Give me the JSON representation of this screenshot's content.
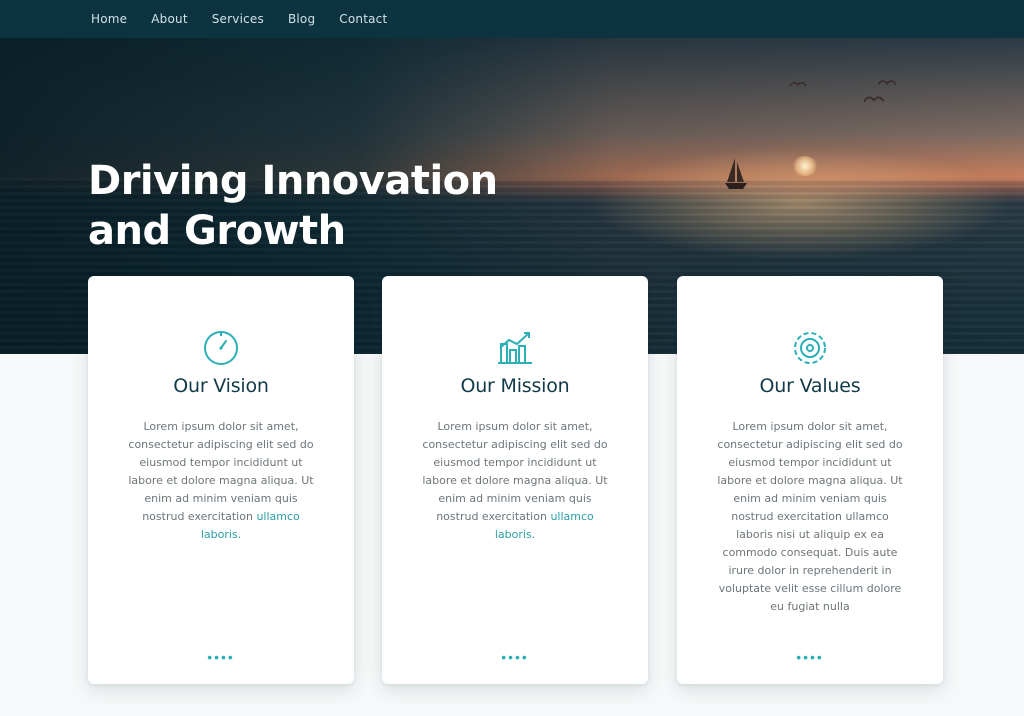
{
  "nav": {
    "items": [
      "Home",
      "About",
      "Services",
      "Blog",
      "Contact"
    ]
  },
  "hero": {
    "title_line1": "Driving Innovation",
    "title_line2": "and Growth"
  },
  "cards": [
    {
      "icon": "clock-icon",
      "title": "Our Vision",
      "body": "Lorem ipsum dolor sit amet, consectetur adipiscing elit sed do eiusmod tempor incididunt ut labore et dolore magna aliqua. Ut enim ad minim veniam quis nostrud exercitation",
      "link": "ullamco laboris.",
      "more": "••••"
    },
    {
      "icon": "growth-chart-icon",
      "title": "Our Mission",
      "body": "Lorem ipsum dolor sit amet, consectetur adipiscing elit sed do eiusmod tempor incididunt ut labore et dolore magna aliqua. Ut enim ad minim veniam quis nostrud exercitation",
      "link": "ullamco laboris.",
      "more": "••••"
    },
    {
      "icon": "gear-icon",
      "title": "Our Values",
      "body": "Lorem ipsum dolor sit amet, consectetur adipiscing elit sed do eiusmod tempor incididunt ut labore et dolore magna aliqua. Ut enim ad minim veniam quis nostrud exercitation ullamco laboris nisi ut aliquip ex ea commodo consequat. Duis aute irure dolor in reprehenderit in voluptate velit esse cillum dolore eu fugiat nulla",
      "link": "",
      "more": "••••"
    }
  ],
  "colors": {
    "nav_bg": "#0d3340",
    "accent": "#2ab0b6",
    "heading": "#133a48",
    "body_text": "#6d767b"
  }
}
